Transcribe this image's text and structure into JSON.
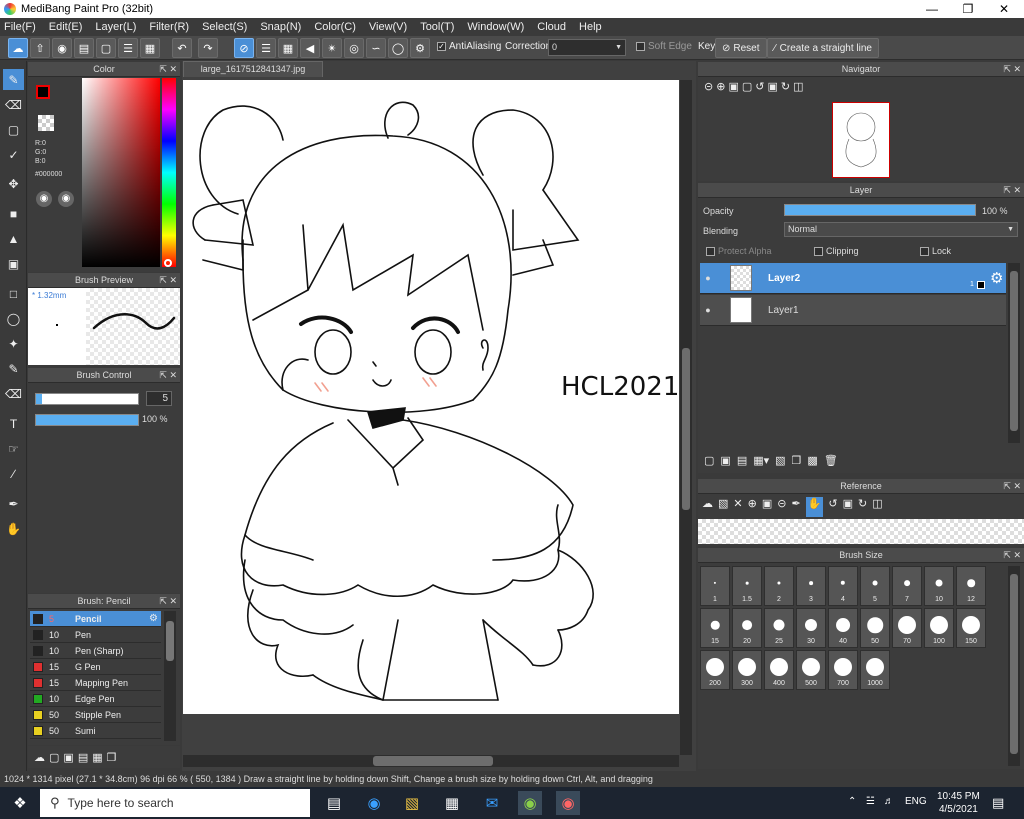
{
  "window": {
    "title": "MediBang Paint Pro (32bit)"
  },
  "menu": [
    "File(F)",
    "Edit(E)",
    "Layer(L)",
    "Filter(R)",
    "Select(S)",
    "Snap(N)",
    "Color(C)",
    "View(V)",
    "Tool(T)",
    "Window(W)",
    "Cloud",
    "Help"
  ],
  "toolbar": {
    "antialiasing": "AntiAliasing",
    "correction_label": "Correction",
    "correction_value": "0",
    "soft_edge": "Soft Edge",
    "key_label": "Key",
    "reset": "Reset",
    "straight_line": "Create a straight line"
  },
  "document": {
    "tab": "large_1617512841347.jpg",
    "signature": "HCL2021"
  },
  "color_panel": {
    "title": "Color",
    "r": "R:0",
    "g": "G:0",
    "b": "B:0",
    "hex": "#000000",
    "main_color": "#000000"
  },
  "brush_preview": {
    "title": "Brush Preview",
    "size": "* 1.32mm"
  },
  "brush_control": {
    "title": "Brush Control",
    "size": "5",
    "opacity": "100 %",
    "opacity_fraction": 1.0
  },
  "brush_list": {
    "title": "Brush: Pencil",
    "items": [
      {
        "size": "5",
        "name": "Pencil",
        "color": "#222222"
      },
      {
        "size": "10",
        "name": "Pen",
        "color": "#222222"
      },
      {
        "size": "10",
        "name": "Pen (Sharp)",
        "color": "#222222"
      },
      {
        "size": "15",
        "name": "G Pen",
        "color": "#e03030"
      },
      {
        "size": "15",
        "name": "Mapping Pen",
        "color": "#e03030"
      },
      {
        "size": "10",
        "name": "Edge Pen",
        "color": "#22aa22"
      },
      {
        "size": "50",
        "name": "Stipple Pen",
        "color": "#e8d020"
      },
      {
        "size": "50",
        "name": "Sumi",
        "color": "#e8d020"
      }
    ]
  },
  "navigator": {
    "title": "Navigator"
  },
  "layer_panel": {
    "title": "Layer",
    "opacity_label": "Opacity",
    "opacity_value": "100 %",
    "opacity_fraction": 1.0,
    "blending_label": "Blending",
    "blending_value": "Normal",
    "protect_alpha": "Protect Alpha",
    "clipping": "Clipping",
    "lock": "Lock",
    "layers": [
      {
        "name": "Layer2",
        "badge": "1"
      },
      {
        "name": "Layer1"
      }
    ]
  },
  "reference": {
    "title": "Reference"
  },
  "brush_size": {
    "title": "Brush Size",
    "sizes": [
      "1",
      "1.5",
      "2",
      "3",
      "4",
      "5",
      "7",
      "10",
      "12",
      "15",
      "20",
      "25",
      "30",
      "40",
      "50",
      "70",
      "100",
      "150",
      "200",
      "300",
      "400",
      "500",
      "700",
      "1000"
    ]
  },
  "status": {
    "text": "1024 * 1314 pixel  (27.1 * 34.8cm)  96 dpi  66 %  ( 550, 1384 )  Draw a straight line by holding down Shift, Change a brush size by holding down Ctrl, Alt, and dragging"
  },
  "taskbar": {
    "search_placeholder": "Type here to search",
    "lang": "ENG",
    "time": "10:45 PM",
    "date": "4/5/2021"
  }
}
